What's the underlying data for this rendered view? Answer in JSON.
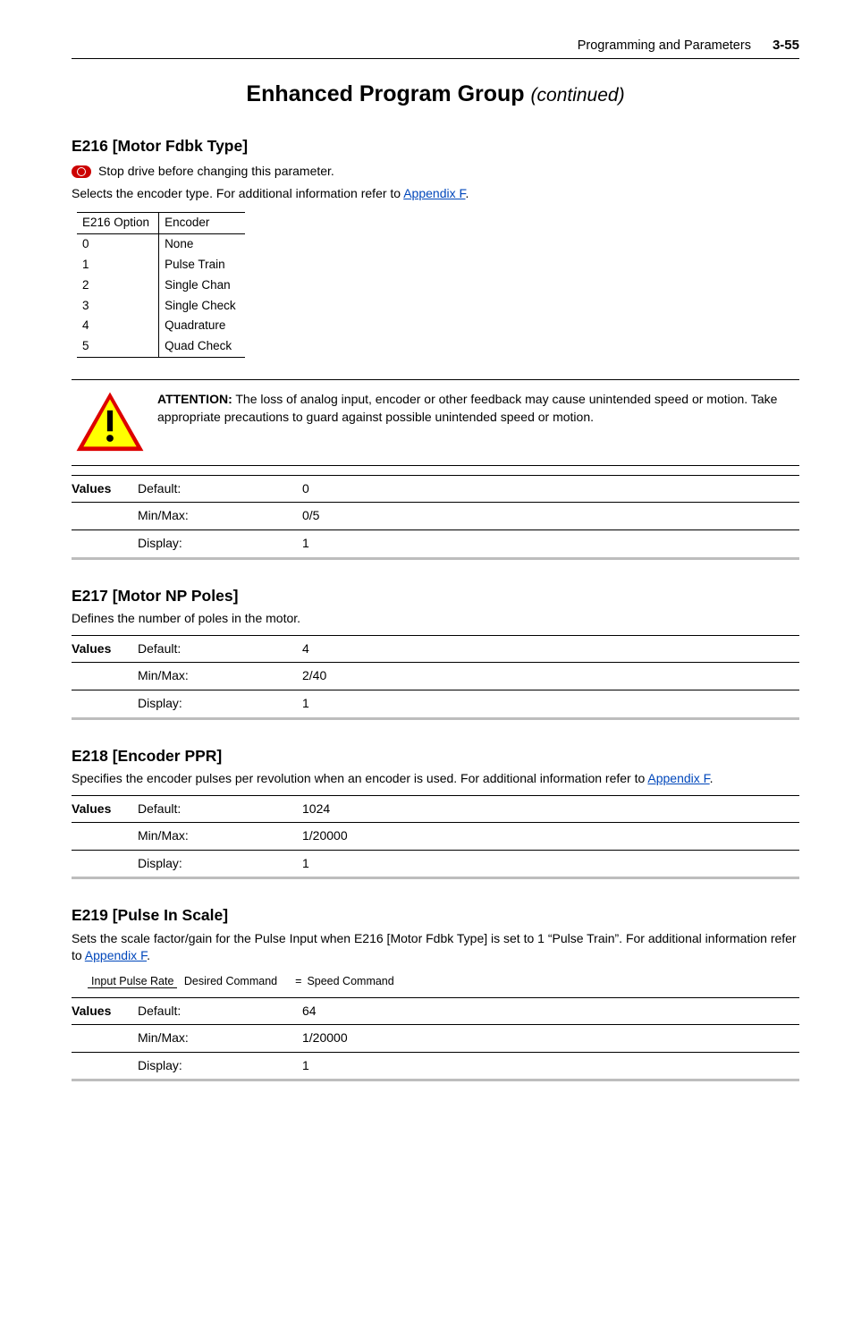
{
  "header": {
    "section": "Programming and Parameters",
    "page": "3-55"
  },
  "group_title": {
    "main": "Enhanced Program Group",
    "suffix": "(continued)"
  },
  "s1": {
    "head": "E216 [Motor Fdbk Type]",
    "stop_note": "Stop drive before changing this parameter.",
    "desc_a": "Selects the encoder type. For additional information refer to ",
    "desc_link": "Appendix F",
    "desc_b": "."
  },
  "enc_table": {
    "h1": "E216 Option",
    "h2": "Encoder",
    "rows": [
      {
        "opt": "0",
        "enc": "None"
      },
      {
        "opt": "1",
        "enc": "Pulse Train"
      },
      {
        "opt": "2",
        "enc": "Single Chan"
      },
      {
        "opt": "3",
        "enc": "Single Check"
      },
      {
        "opt": "4",
        "enc": "Quadrature"
      },
      {
        "opt": "5",
        "enc": "Quad Check"
      }
    ]
  },
  "attention": {
    "label": "ATTENTION:",
    "text": "The loss of analog input, encoder or other feedback may cause unintended speed or motion. Take appropriate precautions to guard against possible unintended speed or motion."
  },
  "values_label": "Values",
  "v1": {
    "default_k": "Default:",
    "default_v": "0",
    "minmax_k": "Min/Max:",
    "minmax_v": "0/5",
    "display_k": "Display:",
    "display_v": "1"
  },
  "s2": {
    "head": "E217 [Motor NP Poles]",
    "desc": "Defines the number of poles in the motor."
  },
  "v2": {
    "default_k": "Default:",
    "default_v": "4",
    "minmax_k": "Min/Max:",
    "minmax_v": "2/40",
    "display_k": "Display:",
    "display_v": "1"
  },
  "s3": {
    "head": "E218 [Encoder PPR]",
    "desc_a": "Specifies the encoder pulses per revolution when an encoder is used. For additional information refer to ",
    "desc_link": "Appendix F",
    "desc_b": "."
  },
  "v3": {
    "default_k": "Default:",
    "default_v": "1024",
    "minmax_k": "Min/Max:",
    "minmax_v": "1/20000",
    "display_k": "Display:",
    "display_v": "1"
  },
  "s4": {
    "head": "E219 [Pulse In Scale]",
    "desc_a": "Sets the scale factor/gain for the Pulse Input when E216 [Motor Fdbk Type] is set to 1 “Pulse Train”. For additional information refer to ",
    "desc_link": "Appendix F",
    "desc_b": "."
  },
  "formula": {
    "top": "Input Pulse Rate",
    "bot": "Desired Command",
    "eq": "=",
    "rhs": "Speed Command"
  },
  "v4": {
    "default_k": "Default:",
    "default_v": "64",
    "minmax_k": "Min/Max:",
    "minmax_v": "1/20000",
    "display_k": "Display:",
    "display_v": "1"
  }
}
